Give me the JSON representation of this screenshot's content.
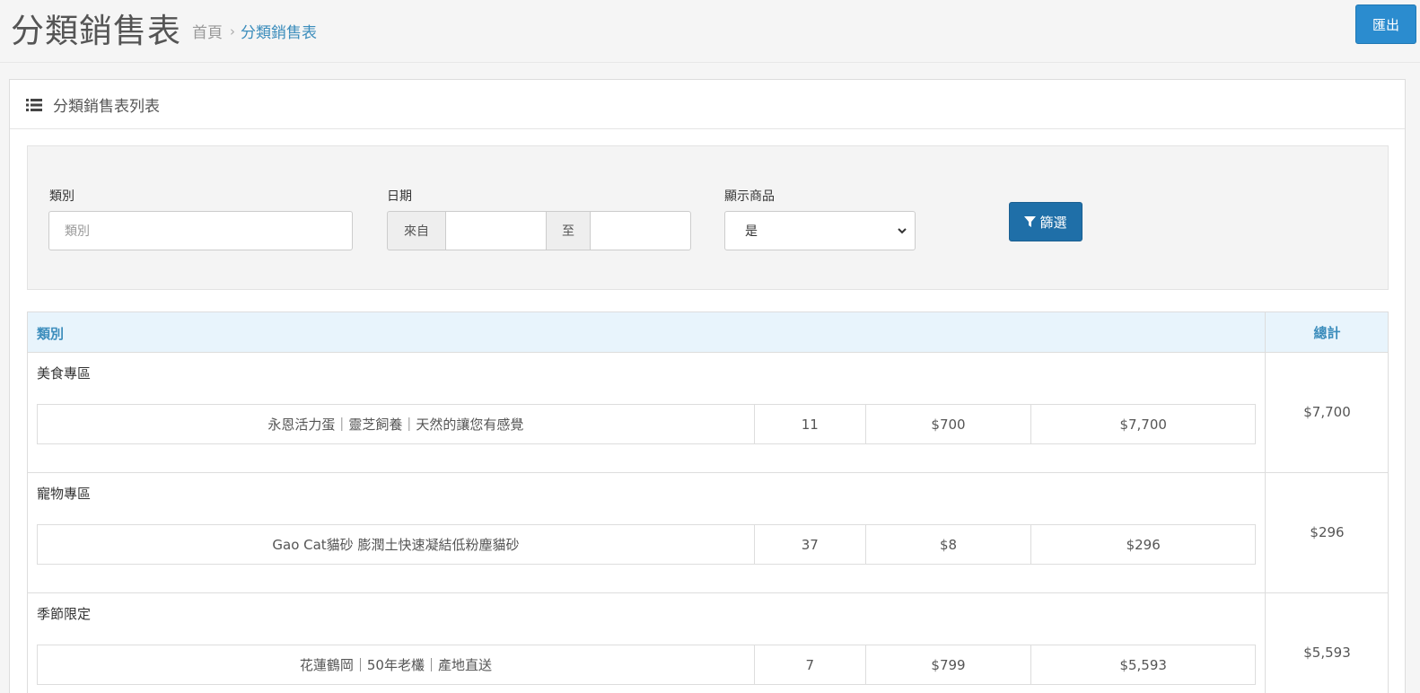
{
  "header": {
    "title": "分類銷售表",
    "breadcrumb": {
      "home": "首頁",
      "separator": "›",
      "current": "分類銷售表"
    },
    "export_label": "匯出"
  },
  "panel": {
    "heading": "分類銷售表列表",
    "heading_icon": "list-icon"
  },
  "filters": {
    "category_label": "類別",
    "category_placeholder": "類別",
    "date_label": "日期",
    "date_from_addon": "來自",
    "date_to_addon": "至",
    "date_from_value": "",
    "date_to_value": "",
    "show_products_label": "顯示商品",
    "show_products_value": "是",
    "filter_button": "篩選",
    "filter_icon": "filter-icon"
  },
  "table": {
    "headers": {
      "category": "類別",
      "total": "總計"
    },
    "rows": [
      {
        "category": "美食專區",
        "total": "$7,700",
        "product": {
          "name": "永恩活力蛋｜靈芝飼養｜天然的讓您有感覺",
          "qty": "11",
          "price": "$700",
          "subtotal": "$7,700"
        }
      },
      {
        "category": "寵物專區",
        "total": "$296",
        "product": {
          "name": "Gao Cat貓砂 膨潤土快速凝結低粉塵貓砂",
          "qty": "37",
          "price": "$8",
          "subtotal": "$296"
        }
      },
      {
        "category": "季節限定",
        "total": "$5,593",
        "product": {
          "name": "花蓮鶴岡｜50年老欉｜產地直送",
          "qty": "7",
          "price": "$799",
          "subtotal": "$5,593"
        }
      }
    ]
  },
  "colors": {
    "primary": "#2b8ccf",
    "filter_button": "#1f6fa8",
    "link": "#3c8dbc",
    "table_header_bg": "#e8f4fc"
  }
}
